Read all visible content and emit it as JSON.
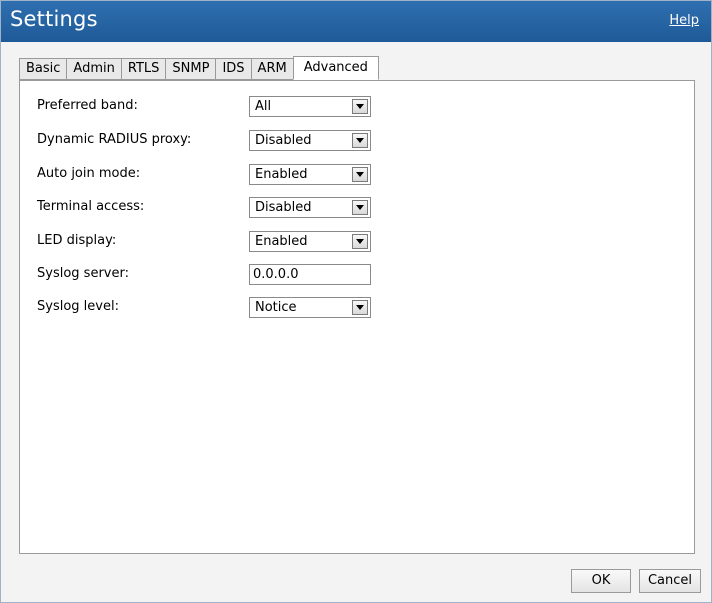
{
  "window": {
    "title": "Settings",
    "help_label": "Help"
  },
  "tabs": [
    {
      "label": "Basic",
      "active": false
    },
    {
      "label": "Admin",
      "active": false
    },
    {
      "label": "RTLS",
      "active": false
    },
    {
      "label": "SNMP",
      "active": false
    },
    {
      "label": "IDS",
      "active": false
    },
    {
      "label": "ARM",
      "active": false
    },
    {
      "label": "Advanced",
      "active": true
    }
  ],
  "fields": {
    "preferred_band": {
      "label": "Preferred band:",
      "value": "All"
    },
    "dynamic_radius_proxy": {
      "label": "Dynamic RADIUS proxy:",
      "value": "Disabled"
    },
    "auto_join_mode": {
      "label": "Auto join mode:",
      "value": "Enabled"
    },
    "terminal_access": {
      "label": "Terminal access:",
      "value": "Disabled"
    },
    "led_display": {
      "label": "LED display:",
      "value": "Enabled"
    },
    "syslog_server": {
      "label": "Syslog server:",
      "value": "0.0.0.0"
    },
    "syslog_level": {
      "label": "Syslog level:",
      "value": "Notice"
    }
  },
  "buttons": {
    "ok": "OK",
    "cancel": "Cancel"
  },
  "colors": {
    "titlebar": "#2f6fb0",
    "title_text": "#ffffff"
  }
}
